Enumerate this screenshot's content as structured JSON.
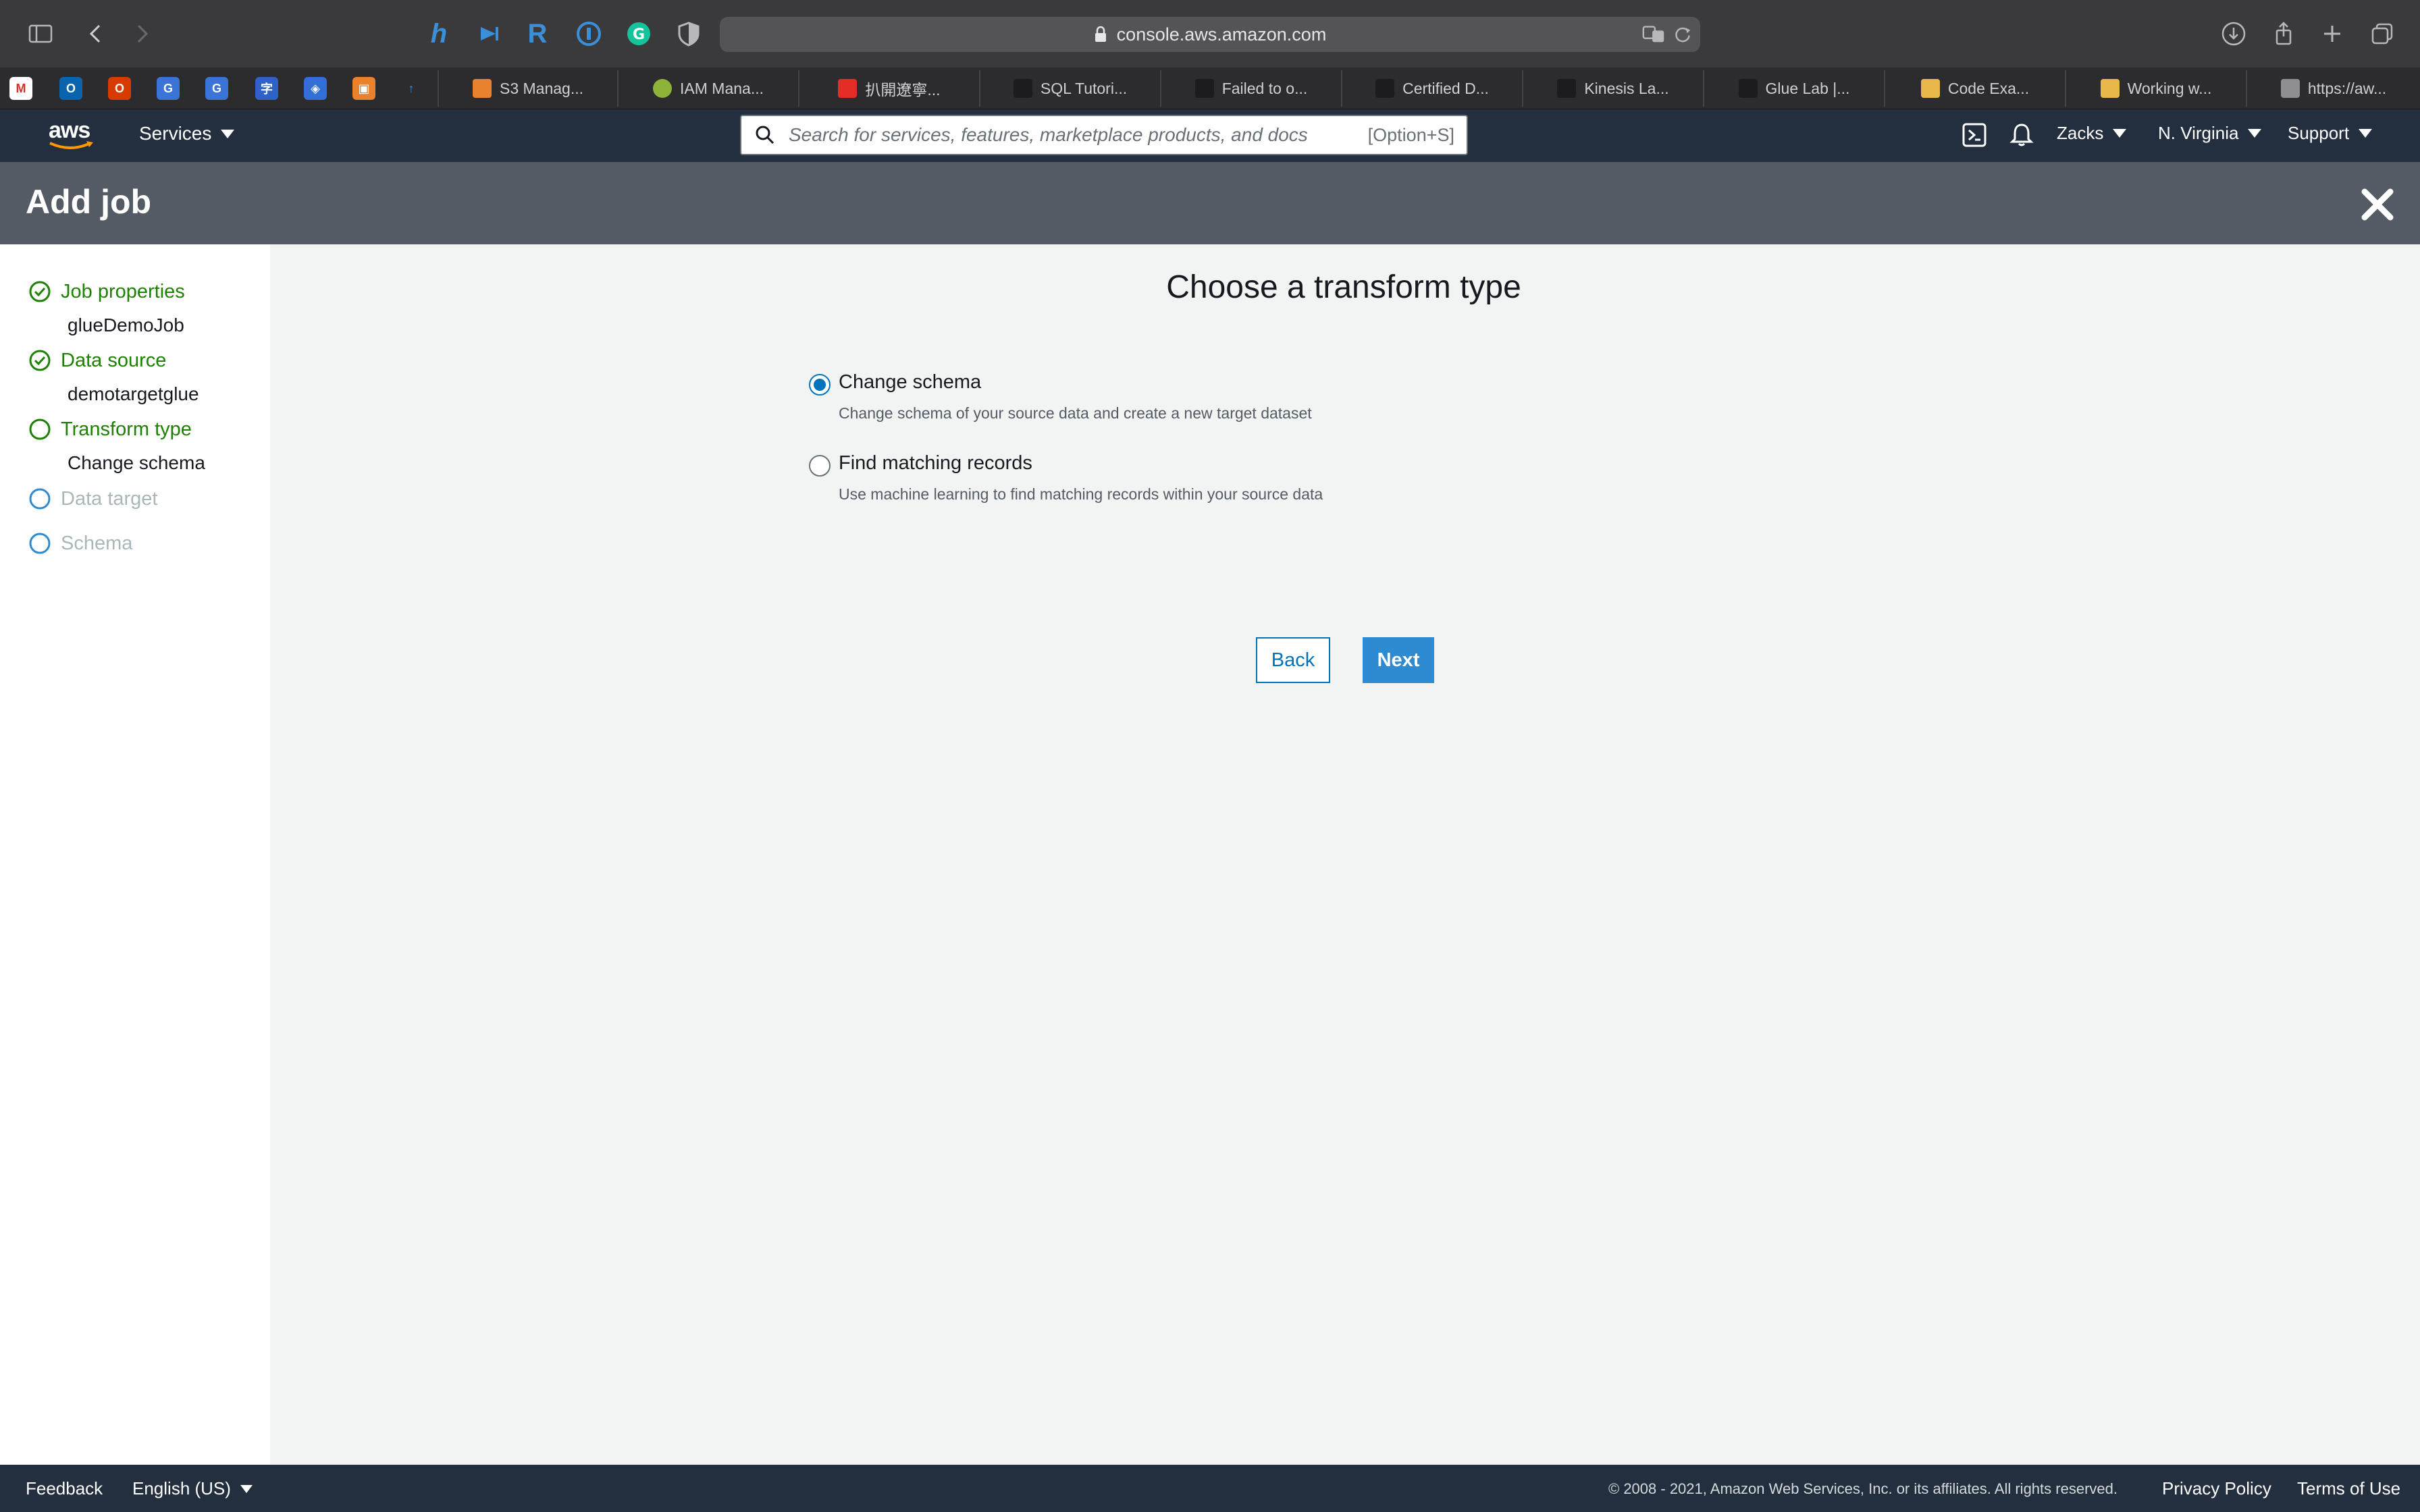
{
  "browser": {
    "url": "console.aws.amazon.com",
    "tabs": [
      {
        "label": "S3 Manag...",
        "favicon_color": "#e8822f"
      },
      {
        "label": "IAM Mana...",
        "favicon_color": "#8db338"
      },
      {
        "label": "扒開遼寧...",
        "favicon_color": "#e52d27"
      },
      {
        "label": "SQL Tutori...",
        "favicon_color": "#1c1c1e"
      },
      {
        "label": "Failed to o...",
        "favicon_color": "#1c1c1e"
      },
      {
        "label": "Certified D...",
        "favicon_color": "#1c1c1e"
      },
      {
        "label": "Kinesis La...",
        "favicon_color": "#1c1c1e"
      },
      {
        "label": "Glue Lab |...",
        "favicon_color": "#1c1c1e"
      },
      {
        "label": "Code Exa...",
        "favicon_color": "#e8b84a"
      },
      {
        "label": "Working w...",
        "favicon_color": "#e8b84a"
      },
      {
        "label": "https://aw...",
        "favicon_color": "#8e8e93"
      }
    ]
  },
  "aws_nav": {
    "logo": "aws",
    "services_label": "Services",
    "search_placeholder": "Search for services, features, marketplace products, and docs",
    "search_shortcut": "[Option+S]",
    "user": "Zacks",
    "region": "N. Virginia",
    "support": "Support"
  },
  "page": {
    "title": "Add job"
  },
  "steps": [
    {
      "label": "Job properties",
      "sub": "glueDemoJob",
      "state": "complete"
    },
    {
      "label": "Data source",
      "sub": "demotargetglue",
      "state": "complete"
    },
    {
      "label": "Transform type",
      "sub": "Change schema",
      "state": "current"
    },
    {
      "label": "Data target",
      "sub": "",
      "state": "pending"
    },
    {
      "label": "Schema",
      "sub": "",
      "state": "pending"
    }
  ],
  "main": {
    "heading": "Choose a transform type",
    "options": [
      {
        "label": "Change schema",
        "description": "Change schema of your source data and create a new target dataset",
        "selected": true
      },
      {
        "label": "Find matching records",
        "description": "Use machine learning to find matching records within your source data",
        "selected": false
      }
    ],
    "back_label": "Back",
    "next_label": "Next"
  },
  "footer": {
    "feedback": "Feedback",
    "language": "English (US)",
    "copyright": "© 2008 - 2021, Amazon Web Services, Inc. or its affiliates. All rights reserved.",
    "privacy": "Privacy Policy",
    "terms": "Terms of Use"
  },
  "colors": {
    "aws_nav_bg": "#232f3e",
    "header_bg": "#545b64",
    "step_green": "#1d8102",
    "primary_blue": "#0073bb",
    "next_button": "#2e8bd1"
  }
}
